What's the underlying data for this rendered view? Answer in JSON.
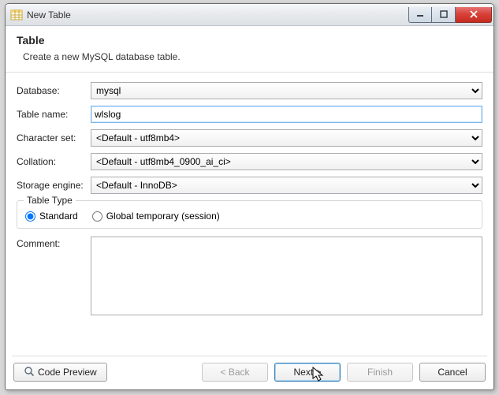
{
  "window": {
    "title": "New Table"
  },
  "header": {
    "title": "Table",
    "description": "Create a new MySQL database table."
  },
  "form": {
    "database": {
      "label": "Database:",
      "value": "mysql"
    },
    "tableName": {
      "label": "Table name:",
      "value": "wlslog"
    },
    "charset": {
      "label": "Character set:",
      "value": "<Default - utf8mb4>"
    },
    "collation": {
      "label": "Collation:",
      "value": "<Default - utf8mb4_0900_ai_ci>"
    },
    "storageEngine": {
      "label": "Storage engine:",
      "value": "<Default - InnoDB>"
    },
    "tableType": {
      "legend": "Table Type",
      "standard": "Standard",
      "globalTemp": "Global temporary (session)",
      "selected": "standard"
    },
    "comment": {
      "label": "Comment:",
      "value": ""
    }
  },
  "buttons": {
    "codePreview": "Code Preview",
    "back": "< Back",
    "next": "Next >",
    "finish": "Finish",
    "cancel": "Cancel"
  }
}
